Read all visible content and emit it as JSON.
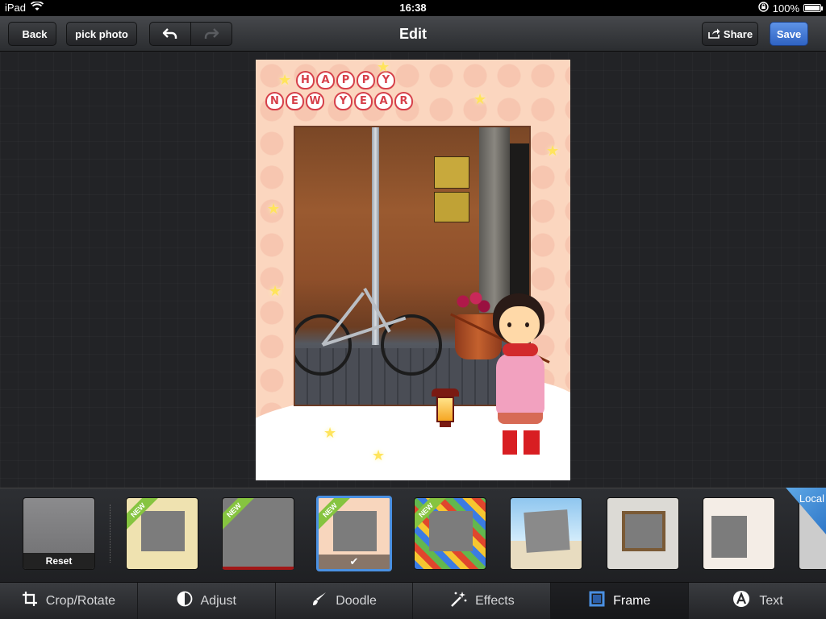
{
  "status": {
    "device": "iPad",
    "time": "16:38",
    "battery": "100%"
  },
  "nav": {
    "back_label": "Back",
    "pick_label": "pick photo",
    "title": "Edit",
    "share_label": "Share",
    "save_label": "Save"
  },
  "greeting": {
    "line1": [
      "H",
      "A",
      "P",
      "P",
      "Y"
    ],
    "line2": [
      "N",
      "E",
      "W",
      "",
      "Y",
      "E",
      "A",
      "R"
    ]
  },
  "strip": {
    "reset_label": "Reset",
    "new_badge": "NEW",
    "local_label": "Local",
    "selected_index": 2
  },
  "tabs": [
    {
      "label": "Crop/Rotate",
      "icon": "crop-icon",
      "active": false
    },
    {
      "label": "Adjust",
      "icon": "contrast-icon",
      "active": false
    },
    {
      "label": "Doodle",
      "icon": "brush-icon",
      "active": false
    },
    {
      "label": "Effects",
      "icon": "sparkle-icon",
      "active": false
    },
    {
      "label": "Frame",
      "icon": "frame-icon",
      "active": true
    },
    {
      "label": "Text",
      "icon": "text-icon",
      "active": false
    }
  ],
  "colors": {
    "accent": "#4a90e2",
    "save": "#3a74d6",
    "new_badge": "#86c440"
  }
}
